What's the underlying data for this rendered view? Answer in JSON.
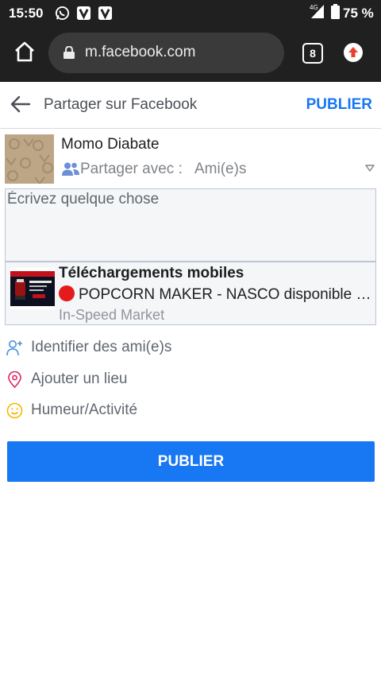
{
  "status_bar": {
    "time": "15:50",
    "network": "4G",
    "battery": "75 %"
  },
  "browser": {
    "url": "m.facebook.com",
    "tab_count": "8"
  },
  "header": {
    "title": "Partager sur Facebook",
    "publish_label": "PUBLIER"
  },
  "author": {
    "name": "Momo Diabate",
    "share_with_label": "Partager avec :",
    "audience": "Ami(e)s"
  },
  "composer": {
    "placeholder": "Écrivez quelque chose",
    "value": ""
  },
  "link_preview": {
    "title": "Téléchargements mobiles",
    "description": "POPCORN MAKER - NASCO disponible chez In-Speed Market",
    "source": "In-Speed Market",
    "thumb_caption": "POPCORN MAKER NASCO"
  },
  "actions": [
    {
      "label": "Identifier des ami(e)s",
      "icon": "tag-friends-icon",
      "color": "#4a90d9"
    },
    {
      "label": "Ajouter un lieu",
      "icon": "location-pin-icon",
      "color": "#e0245e"
    },
    {
      "label": "Humeur/Activité",
      "icon": "smiley-icon",
      "color": "#f5b800"
    }
  ],
  "footer": {
    "publish_label": "PUBLIER"
  },
  "colors": {
    "accent": "#1877f2",
    "status_bar": "#202020"
  }
}
